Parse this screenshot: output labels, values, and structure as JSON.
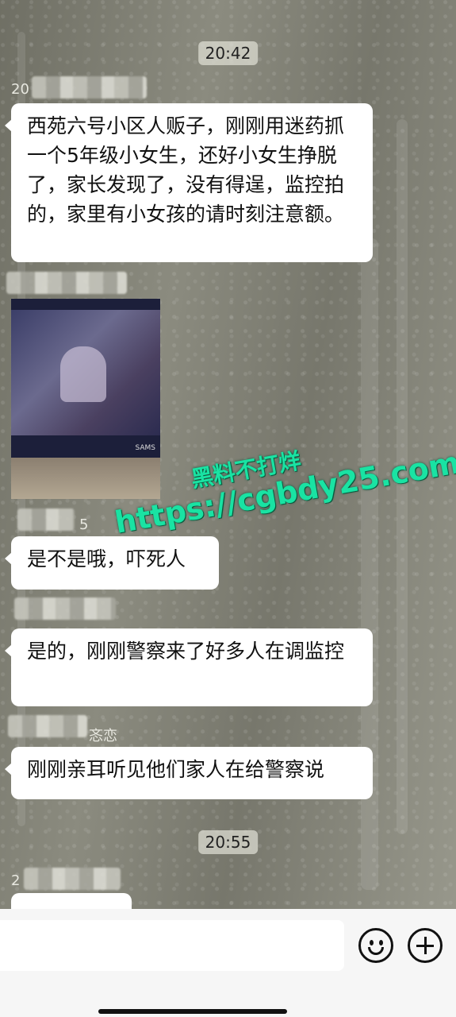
{
  "chat": {
    "time1": "20:42",
    "time2": "20:55",
    "sender1_prefix": "20",
    "sender3_suffix": "5",
    "sender5_suffix": "忞恋",
    "sender6_prefix": "2",
    "messages": [
      {
        "text": "西苑六号小区人贩子，刚刚用迷药抓一个5年级小女生，还好小女生挣脱了，家长发现了，没有得逞，监控拍的，家里有小女孩的请时刻注意额。"
      },
      {
        "text": "是不是哦，吓死人"
      },
      {
        "text": "是的，刚刚警察来了好多人在调监控"
      },
      {
        "text": "刚刚亲耳听见他们家人在给警察说"
      }
    ],
    "photo_brand": "SAMS"
  },
  "watermark": {
    "line1": "黑料不打烊",
    "line2": "https://cgbdy25.com",
    "color": "#19e3a3"
  },
  "input_bar": {
    "emoji_icon": "smile-emoji-icon",
    "plus_icon": "plus-circle-icon"
  }
}
